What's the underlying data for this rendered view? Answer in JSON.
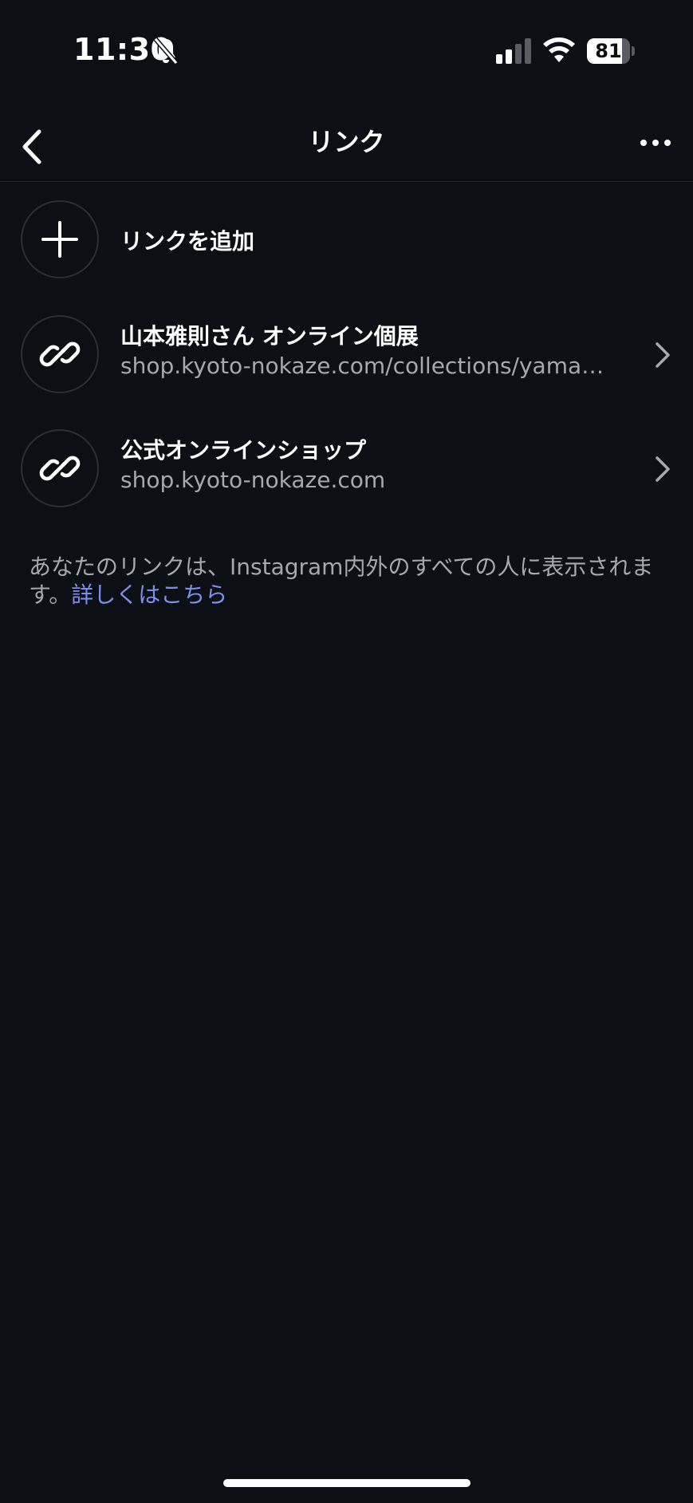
{
  "status_bar": {
    "time": "11:30",
    "battery_level": "81",
    "battery_fraction": 0.81,
    "icons": [
      "bell-slash-icon",
      "signal-icon",
      "wifi-icon",
      "battery-icon"
    ]
  },
  "header": {
    "title": "リンク",
    "back_icon": "chevron-left-icon",
    "more_icon": "ellipsis-icon"
  },
  "add_link": {
    "label": "リンクを追加",
    "icon": "plus-icon"
  },
  "links": [
    {
      "title": "山本雅則さん オンライン個展",
      "url": "shop.kyoto-nokaze.com/collections/yamamoto-masanori-online-exhibition",
      "icon": "link-icon"
    },
    {
      "title": "公式オンラインショップ",
      "url": "shop.kyoto-nokaze.com",
      "icon": "link-icon"
    }
  ],
  "note": {
    "text": "あなたのリンクは、Instagram内外のすべての人に表示されます。",
    "link_label": "詳しくはこちら"
  },
  "colors": {
    "background": "#0c0f14",
    "primary_text": "#ffffff",
    "secondary_text": "#a6a8ad",
    "link_text": "#7b90f0",
    "border": "#2c2f35"
  }
}
